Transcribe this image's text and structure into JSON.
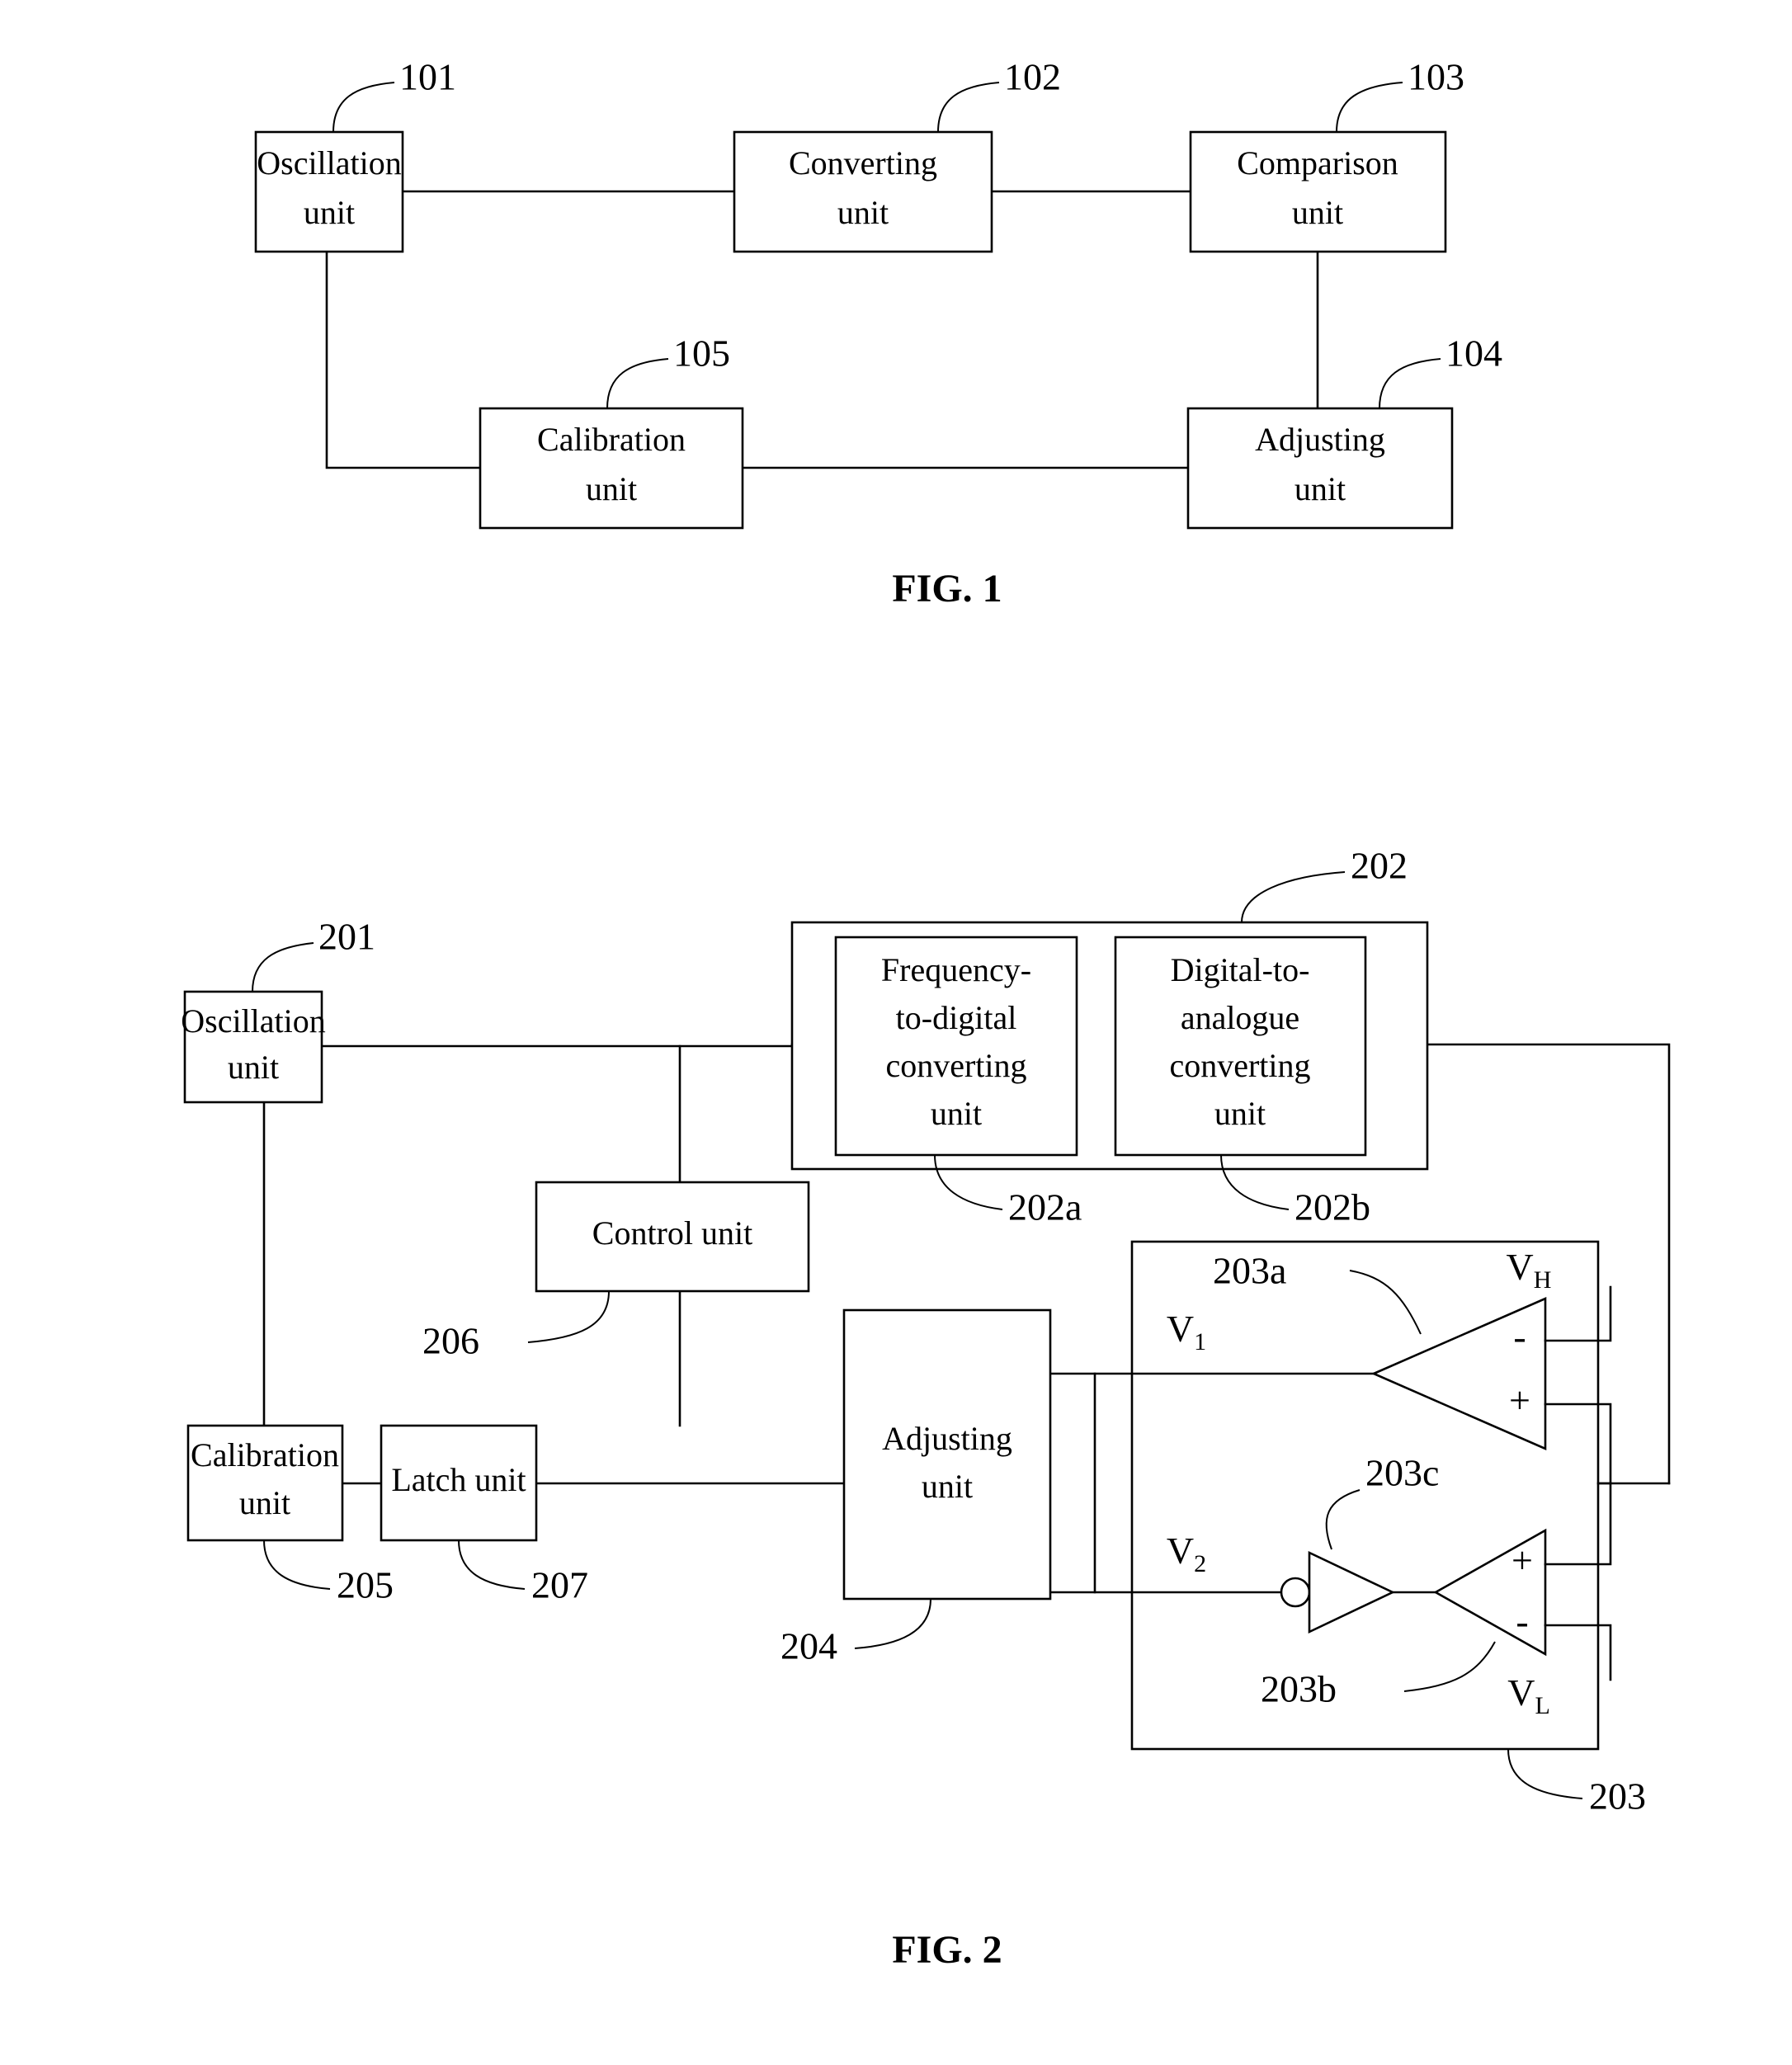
{
  "document": {
    "kind": "patent-figure-sheet",
    "figures": [
      {
        "caption": "FIG. 1",
        "blocks": [
          {
            "ref": "101",
            "label_line1": "Oscillation",
            "label_line2": "unit"
          },
          {
            "ref": "102",
            "label_line1": "Converting",
            "label_line2": "unit"
          },
          {
            "ref": "103",
            "label_line1": "Comparison",
            "label_line2": "unit"
          },
          {
            "ref": "104",
            "label_line1": "Adjusting",
            "label_line2": "unit"
          },
          {
            "ref": "105",
            "label_line1": "Calibration",
            "label_line2": "unit"
          }
        ]
      },
      {
        "caption": "FIG. 2",
        "blocks": [
          {
            "ref": "201",
            "label_line1": "Oscillation",
            "label_line2": "unit"
          },
          {
            "ref": "202",
            "label_line1": "",
            "label_line2": ""
          },
          {
            "ref": "202a",
            "label_line1": "Frequency-",
            "label_line2": "to-digital",
            "label_line3": "converting",
            "label_line4": "unit"
          },
          {
            "ref": "202b",
            "label_line1": "Digital-to-",
            "label_line2": "analogue",
            "label_line3": "converting",
            "label_line4": "unit"
          },
          {
            "ref": "203",
            "label_line1": "",
            "label_line2": ""
          },
          {
            "ref": "203a",
            "label_line1": "",
            "label_line2": ""
          },
          {
            "ref": "203b",
            "label_line1": "",
            "label_line2": ""
          },
          {
            "ref": "203c",
            "label_line1": "",
            "label_line2": ""
          },
          {
            "ref": "204",
            "label_line1": "Adjusting",
            "label_line2": "unit"
          },
          {
            "ref": "205",
            "label_line1": "Calibration",
            "label_line2": "unit"
          },
          {
            "ref": "206",
            "label_line1": "Control unit",
            "label_line2": ""
          },
          {
            "ref": "207",
            "label_line1": "Latch unit",
            "label_line2": ""
          }
        ],
        "signals": [
          {
            "name": "V",
            "sub": "1"
          },
          {
            "name": "V",
            "sub": "2"
          },
          {
            "name": "V",
            "sub": "H"
          },
          {
            "name": "V",
            "sub": "L"
          }
        ],
        "pins": [
          "-",
          "+",
          "+",
          "-"
        ]
      }
    ]
  },
  "fig1": {
    "caption": "FIG. 1",
    "oscillation": {
      "l1": "Oscillation",
      "l2": "unit",
      "ref": "101"
    },
    "converting": {
      "l1": "Converting",
      "l2": "unit",
      "ref": "102"
    },
    "comparison": {
      "l1": "Comparison",
      "l2": "unit",
      "ref": "103"
    },
    "adjusting": {
      "l1": "Adjusting",
      "l2": "unit",
      "ref": "104"
    },
    "calibration": {
      "l1": "Calibration",
      "l2": "unit",
      "ref": "105"
    }
  },
  "fig2": {
    "caption": "FIG. 2",
    "oscillation": {
      "l1": "Oscillation",
      "l2": "unit",
      "ref": "201"
    },
    "converting_group": {
      "ref": "202"
    },
    "freq_to_digital": {
      "l1": "Frequency-",
      "l2": "to-digital",
      "l3": "converting",
      "l4": "unit",
      "ref": "202a"
    },
    "digital_to_analogue": {
      "l1": "Digital-to-",
      "l2": "analogue",
      "l3": "converting",
      "l4": "unit",
      "ref": "202b"
    },
    "comparison_group": {
      "ref": "203"
    },
    "comparator_high": {
      "ref": "203a",
      "pin_top": "-",
      "pin_bottom": "+"
    },
    "comparator_low": {
      "ref": "203b",
      "pin_top": "+",
      "pin_bottom": "-"
    },
    "inverter": {
      "ref": "203c"
    },
    "adjusting": {
      "l1": "Adjusting",
      "l2": "unit",
      "ref": "204"
    },
    "calibration": {
      "l1": "Calibration",
      "l2": "unit",
      "ref": "205"
    },
    "control": {
      "l1": "Control unit",
      "ref": "206"
    },
    "latch": {
      "l1": "Latch unit",
      "ref": "207"
    },
    "v1": {
      "base": "V",
      "sub": "1"
    },
    "v2": {
      "base": "V",
      "sub": "2"
    },
    "vh": {
      "base": "V",
      "sub": "H"
    },
    "vl": {
      "base": "V",
      "sub": "L"
    }
  },
  "colors": {
    "ink": "#000000",
    "paper": "#ffffff"
  }
}
